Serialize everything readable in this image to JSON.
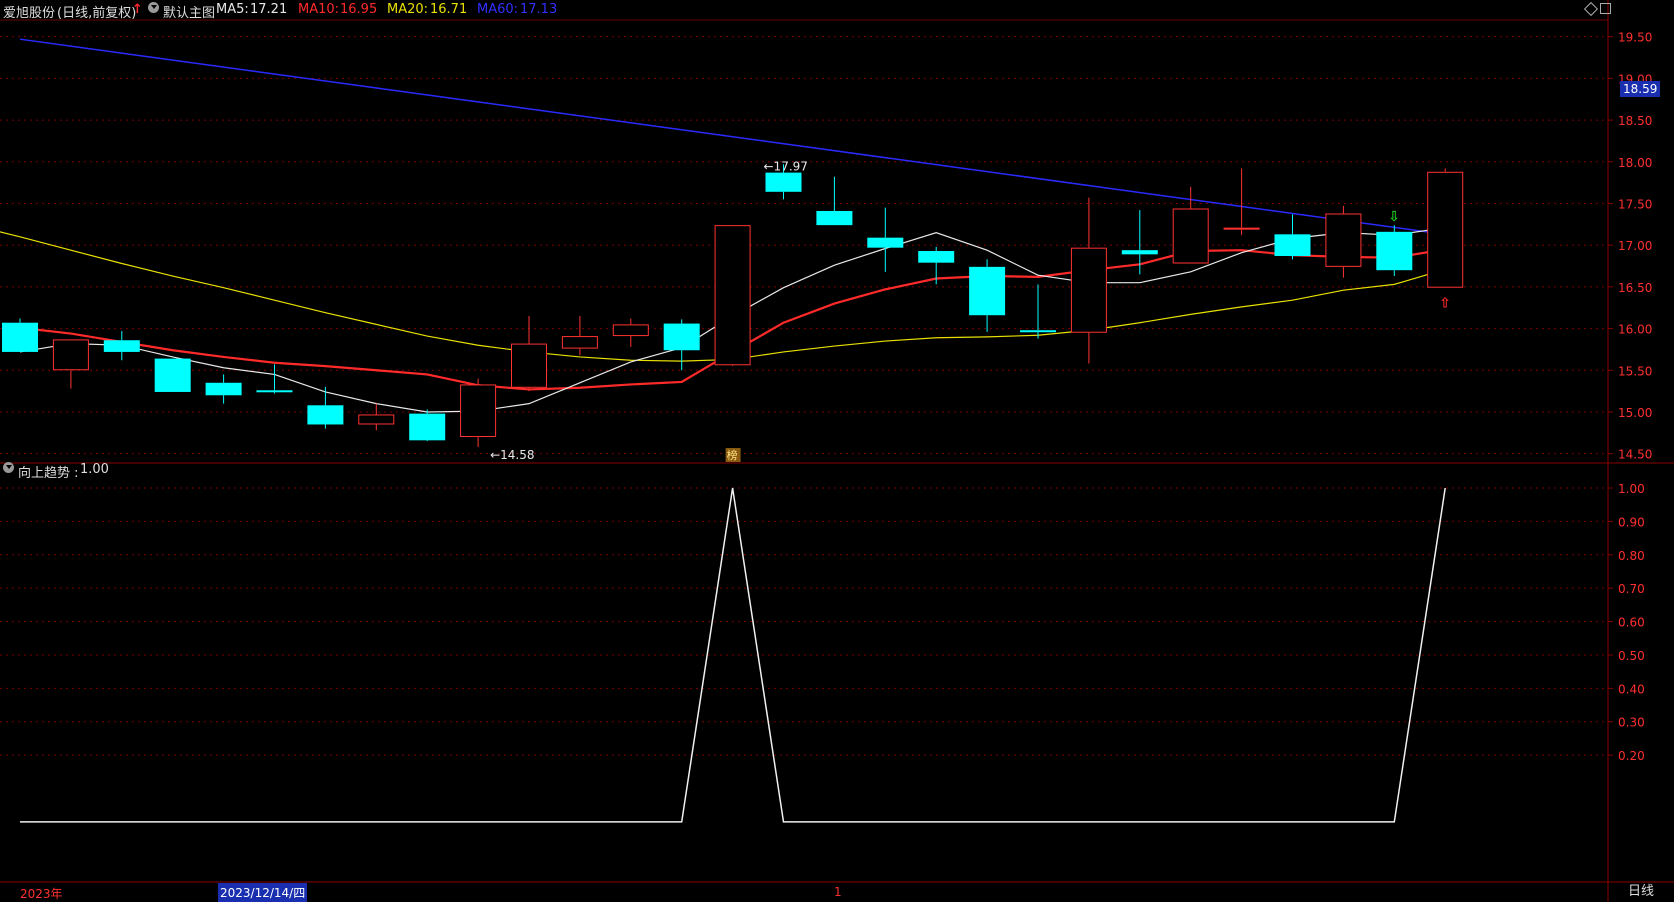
{
  "header": {
    "stock_name": "爱旭股份",
    "mode": "(日线,前复权)",
    "main_chart_label": "默认主图",
    "ma5": {
      "label": "MA5:",
      "value": "17.21",
      "color": "#e8e8e8"
    },
    "ma10": {
      "label": "MA10:",
      "value": "16.95",
      "color": "#ff2a2a"
    },
    "ma20": {
      "label": "MA20:",
      "value": "16.71",
      "color": "#e8e000"
    },
    "ma60": {
      "label": "MA60:",
      "value": "17.13",
      "color": "#2a2aff"
    }
  },
  "sub_header": {
    "indicator_label": "向上趋势 :",
    "indicator_value": "1.00"
  },
  "bottom_bar": {
    "year_label": "2023年",
    "date_cursor": "2023/12/14/四",
    "month_tick": "1"
  },
  "period_button": "日线",
  "price_axis": {
    "current_price_badge": "18.59"
  },
  "annotations": {
    "high_label": "17.97",
    "low_label": "14.58",
    "list_badge": "榜"
  },
  "chart_data": [
    {
      "type": "candlestick",
      "ylim": [
        14.4,
        19.7
      ],
      "yticks": [
        "14.50",
        "15.00",
        "15.50",
        "16.00",
        "16.50",
        "17.00",
        "17.50",
        "18.00",
        "18.50",
        "19.00",
        "19.50"
      ],
      "colors": {
        "up": "#ff3232",
        "down": "#00ffff",
        "ma5": "#e8e8e8",
        "ma10": "#ff2a2a",
        "ma20": "#e8e000",
        "ma60": "#2a2aff",
        "grid": "#7a0000"
      },
      "candles": [
        {
          "o": 16.07,
          "h": 16.12,
          "l": 15.72,
          "c": 15.72
        },
        {
          "o": 15.5,
          "h": 15.87,
          "l": 15.28,
          "c": 15.87
        },
        {
          "o": 15.86,
          "h": 15.97,
          "l": 15.62,
          "c": 15.72
        },
        {
          "o": 15.64,
          "h": 15.64,
          "l": 15.24,
          "c": 15.24
        },
        {
          "o": 15.35,
          "h": 15.45,
          "l": 15.1,
          "c": 15.2
        },
        {
          "o": 15.26,
          "h": 15.57,
          "l": 15.22,
          "c": 15.24
        },
        {
          "o": 15.08,
          "h": 15.3,
          "l": 14.8,
          "c": 14.85
        },
        {
          "o": 14.85,
          "h": 15.1,
          "l": 14.78,
          "c": 14.97
        },
        {
          "o": 14.98,
          "h": 15.03,
          "l": 14.65,
          "c": 14.66
        },
        {
          "o": 14.7,
          "h": 15.4,
          "l": 14.58,
          "c": 15.33
        },
        {
          "o": 15.29,
          "h": 16.15,
          "l": 15.25,
          "c": 15.82
        },
        {
          "o": 15.76,
          "h": 16.15,
          "l": 15.68,
          "c": 15.91
        },
        {
          "o": 15.91,
          "h": 16.12,
          "l": 15.78,
          "c": 16.05
        },
        {
          "o": 16.06,
          "h": 16.11,
          "l": 15.5,
          "c": 15.74
        },
        {
          "o": 15.56,
          "h": 17.24,
          "l": 15.55,
          "c": 17.24
        },
        {
          "o": 17.87,
          "h": 17.97,
          "l": 17.55,
          "c": 17.64
        },
        {
          "o": 17.41,
          "h": 17.82,
          "l": 17.24,
          "c": 17.24
        },
        {
          "o": 17.09,
          "h": 17.45,
          "l": 16.68,
          "c": 16.97
        },
        {
          "o": 16.93,
          "h": 16.98,
          "l": 16.53,
          "c": 16.79
        },
        {
          "o": 16.74,
          "h": 16.83,
          "l": 15.96,
          "c": 16.16
        },
        {
          "o": 15.98,
          "h": 16.53,
          "l": 15.88,
          "c": 15.96
        },
        {
          "o": 15.95,
          "h": 17.57,
          "l": 15.58,
          "c": 16.97
        },
        {
          "o": 16.94,
          "h": 17.42,
          "l": 16.65,
          "c": 16.89
        },
        {
          "o": 16.78,
          "h": 17.7,
          "l": 16.78,
          "c": 17.44
        },
        {
          "o": 17.2,
          "h": 17.92,
          "l": 17.12,
          "c": 17.21
        },
        {
          "o": 17.13,
          "h": 17.37,
          "l": 16.83,
          "c": 16.87
        },
        {
          "o": 16.74,
          "h": 17.47,
          "l": 16.61,
          "c": 17.38
        },
        {
          "o": 17.16,
          "h": 17.24,
          "l": 16.63,
          "c": 16.7
        },
        {
          "o": 16.49,
          "h": 17.92,
          "l": 16.49,
          "c": 17.88
        }
      ],
      "ma5": [
        15.72,
        15.82,
        15.8,
        15.66,
        15.53,
        15.45,
        15.24,
        15.1,
        15.0,
        15.01,
        15.1,
        15.35,
        15.6,
        15.77,
        16.15,
        16.49,
        16.76,
        16.96,
        17.15,
        16.94,
        16.64,
        16.55,
        16.55,
        16.68,
        16.91,
        17.08,
        17.15,
        17.12,
        17.21
      ],
      "ma10": [
        16.01,
        15.94,
        15.84,
        15.74,
        15.66,
        15.59,
        15.55,
        15.5,
        15.45,
        15.32,
        15.27,
        15.29,
        15.33,
        15.36,
        15.72,
        16.07,
        16.3,
        16.47,
        16.6,
        16.63,
        16.62,
        16.7,
        16.77,
        16.93,
        16.94,
        16.88,
        16.86,
        16.85,
        16.95
      ],
      "ma20": [
        17.25,
        17.1,
        16.94,
        16.78,
        16.63,
        16.49,
        16.34,
        16.19,
        16.05,
        15.91,
        15.8,
        15.72,
        15.66,
        15.62,
        15.61,
        15.63,
        15.72,
        15.79,
        15.85,
        15.89,
        15.9,
        15.92,
        15.98,
        16.07,
        16.17,
        16.26,
        16.34,
        16.46,
        16.53,
        16.71
      ],
      "ma60_start": 19.47,
      "ma60_end": 17.13,
      "annotation_high": {
        "index": 15,
        "value": 17.97
      },
      "annotation_low": {
        "index": 9,
        "value": 14.58
      },
      "signal_down_index": 27,
      "signal_up_index": 28
    },
    {
      "type": "line",
      "series": [
        {
          "name": "向上趋势",
          "values": [
            0,
            0,
            0,
            0,
            0,
            0,
            0,
            0,
            0,
            0,
            0,
            0,
            0,
            0,
            1,
            0,
            0,
            0,
            0,
            0,
            0,
            0,
            0,
            0,
            0,
            0,
            0,
            0,
            1
          ]
        }
      ],
      "ylim": [
        -0.18,
        1.03
      ],
      "yticks": [
        "0.20",
        "0.30",
        "0.40",
        "0.50",
        "0.60",
        "0.70",
        "0.80",
        "0.90",
        "1.00"
      ],
      "color": "#f0f0f0"
    }
  ]
}
